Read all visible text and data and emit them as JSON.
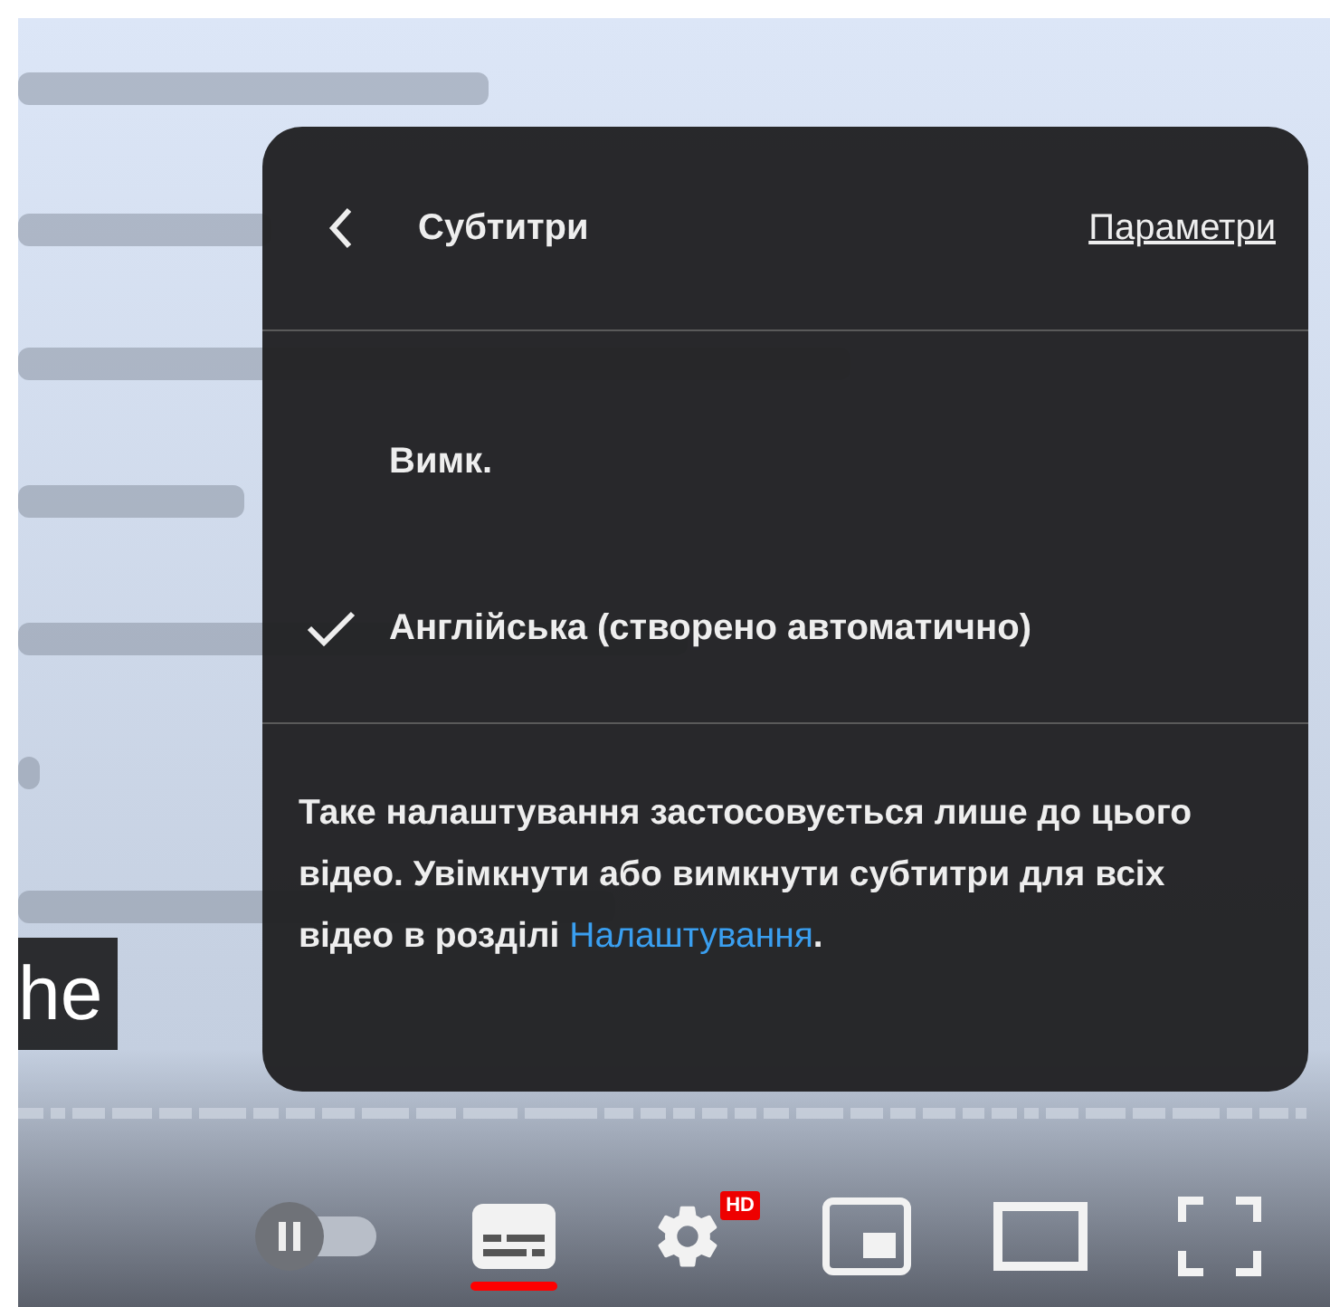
{
  "caption": {
    "text": "he"
  },
  "subtitles_menu": {
    "title": "Субтитри",
    "options_link": "Параметри",
    "items": [
      {
        "label": "Вимк.",
        "selected": false
      },
      {
        "label": "Англійська (створено автоматично)",
        "selected": true
      }
    ],
    "note": {
      "text": "Таке налаштування застосовується лише до цього відео. Увімкнути або вимкнути субтитри для всіх відео в розділі",
      "link": "Налаштування",
      "after": "."
    }
  },
  "controls": {
    "autoplay_on": false,
    "subtitles_on": true,
    "quality_badge": "HD"
  }
}
